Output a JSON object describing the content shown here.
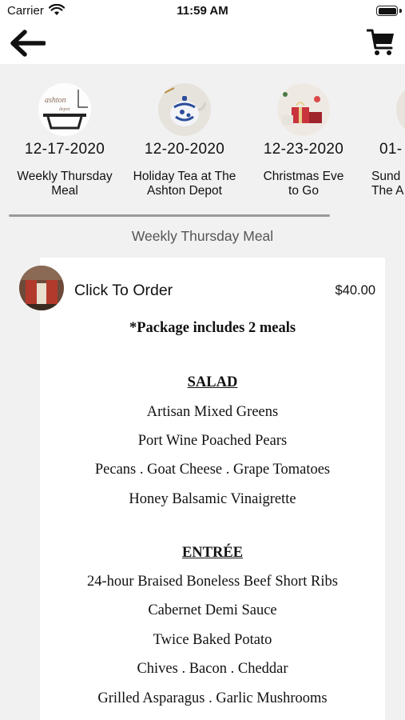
{
  "status_bar": {
    "carrier": "Carrier",
    "time": "11:59 AM",
    "battery_level": 1.0
  },
  "nav": {
    "back_icon": "arrow-left-icon",
    "cart_icon": "shopping-cart-icon"
  },
  "events": [
    {
      "date": "12-17-2020",
      "title": "Weekly Thursday\nMeal",
      "thumb": "ashton-depot-logo"
    },
    {
      "date": "12-20-2020",
      "title": "Holiday Tea at The\nAshton Depot",
      "thumb": "teapot-photo"
    },
    {
      "date": "12-23-2020",
      "title": "Christmas Eve\nto Go",
      "thumb": "gift-boxes-photo"
    },
    {
      "date": "01-",
      "title": "Sund\nThe A",
      "thumb": "partial-photo"
    }
  ],
  "selected_event_title": "Weekly Thursday Meal",
  "order": {
    "label": "Click To Order",
    "price": "$40.00"
  },
  "menu": {
    "package_note": "*Package includes 2 meals",
    "sections": [
      {
        "heading": "SALAD",
        "items": [
          "Artisan Mixed Greens",
          "Port Wine Poached Pears",
          "Pecans . Goat Cheese . Grape Tomatoes",
          "Honey Balsamic Vinaigrette"
        ]
      },
      {
        "heading": "ENTRÉE",
        "items": [
          "24-hour Braised Boneless Beef Short Ribs",
          "Cabernet Demi Sauce",
          "Twice Baked Potato",
          "Chives . Bacon . Cheddar",
          "Grilled Asparagus . Garlic Mushrooms"
        ]
      }
    ]
  },
  "colors": {
    "background_gray": "#f1f1f1",
    "text": "#111111",
    "subtitle_gray": "#555555"
  }
}
